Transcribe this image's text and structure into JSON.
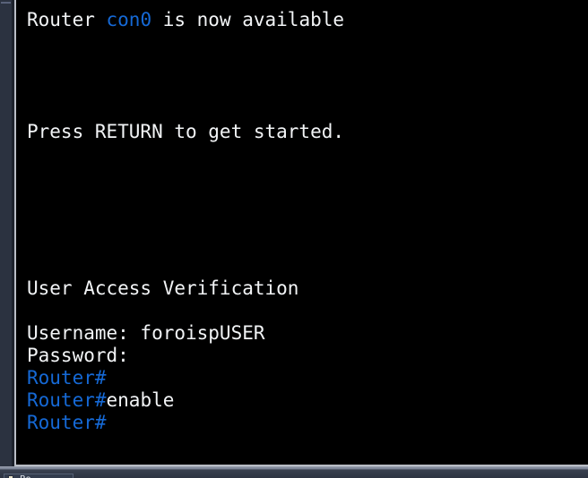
{
  "window": {
    "side_panel_name": "window-side-panel"
  },
  "terminal": {
    "prompt_symbol": "#",
    "colors": {
      "background": "#000000",
      "foreground": "#f2f4f6",
      "accent_blue": "#1569d6",
      "frame": "#b9bdc5",
      "chrome": "#2b3240"
    },
    "lines": [
      {
        "id": "line-1",
        "segments": [
          {
            "text": "Router ",
            "color": "white"
          },
          {
            "text": "con0",
            "color": "blue"
          },
          {
            "text": " is now available",
            "color": "white"
          }
        ]
      },
      {
        "id": "line-2",
        "segments": []
      },
      {
        "id": "line-3",
        "segments": []
      },
      {
        "id": "line-4",
        "segments": []
      },
      {
        "id": "line-5",
        "segments": []
      },
      {
        "id": "line-6",
        "segments": [
          {
            "text": "Press RETURN to get started.",
            "color": "white"
          }
        ]
      },
      {
        "id": "line-7",
        "segments": []
      },
      {
        "id": "line-8",
        "segments": []
      },
      {
        "id": "line-9",
        "segments": []
      },
      {
        "id": "line-10",
        "segments": []
      },
      {
        "id": "line-11",
        "segments": []
      },
      {
        "id": "line-12",
        "segments": []
      },
      {
        "id": "line-13",
        "segments": [
          {
            "text": "User Access Verification",
            "color": "white"
          }
        ]
      },
      {
        "id": "line-14",
        "segments": []
      },
      {
        "id": "line-15",
        "segments": [
          {
            "text": "Username: foroispUSER",
            "color": "white"
          }
        ]
      },
      {
        "id": "line-16",
        "segments": [
          {
            "text": "Password:",
            "color": "white"
          }
        ]
      },
      {
        "id": "line-17",
        "segments": [
          {
            "text": "Router#",
            "color": "blue"
          }
        ]
      },
      {
        "id": "line-18",
        "segments": [
          {
            "text": "Router#",
            "color": "blue"
          },
          {
            "text": "enable",
            "color": "white"
          }
        ]
      },
      {
        "id": "line-19",
        "segments": [
          {
            "text": "Router#",
            "color": "blue"
          }
        ]
      }
    ]
  },
  "taskbar": {
    "items": [
      {
        "label": "Ro",
        "icon": "window-icon"
      }
    ]
  }
}
